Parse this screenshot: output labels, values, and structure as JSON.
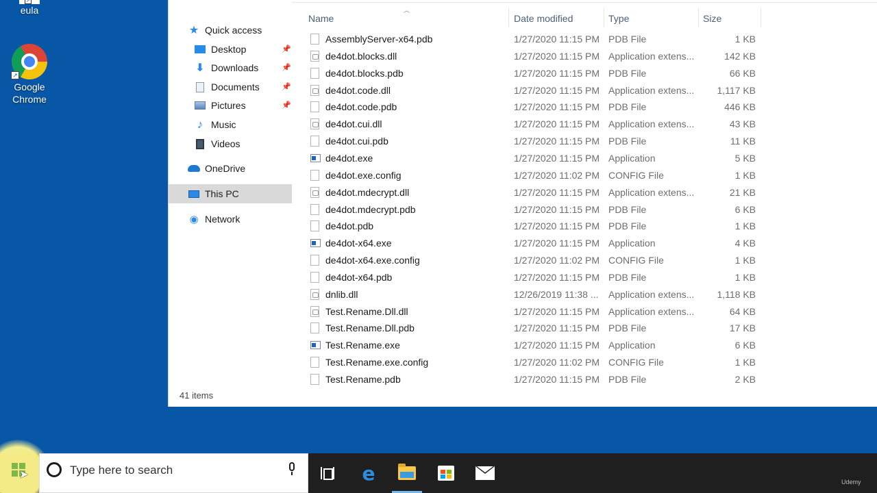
{
  "desktop": {
    "icons": [
      {
        "label": "eula"
      },
      {
        "label": "Google Chrome"
      }
    ]
  },
  "explorer": {
    "nav": {
      "items": [
        {
          "label": "Quick access",
          "icon": "star-icon"
        },
        {
          "label": "Desktop",
          "icon": "desktop-icon",
          "pinned": true
        },
        {
          "label": "Downloads",
          "icon": "download-arrow-icon",
          "pinned": true
        },
        {
          "label": "Documents",
          "icon": "documents-icon",
          "pinned": true
        },
        {
          "label": "Pictures",
          "icon": "pictures-icon",
          "pinned": true
        },
        {
          "label": "Music",
          "icon": "music-note-icon"
        },
        {
          "label": "Videos",
          "icon": "videos-icon"
        },
        {
          "label": "OneDrive",
          "icon": "cloud-icon"
        },
        {
          "label": "This PC",
          "icon": "computer-icon",
          "selected": true
        },
        {
          "label": "Network",
          "icon": "network-icon"
        }
      ],
      "pin_glyph": "📌"
    },
    "columns": {
      "name": "Name",
      "date": "Date modified",
      "type": "Type",
      "size": "Size"
    },
    "files": [
      {
        "name": "AssemblyServer-x64.pdb",
        "date": "1/27/2020 11:15 PM",
        "type": "PDB File",
        "size": "1 KB",
        "kind": "file"
      },
      {
        "name": "de4dot.blocks.dll",
        "date": "1/27/2020 11:15 PM",
        "type": "Application extens...",
        "size": "142 KB",
        "kind": "dll"
      },
      {
        "name": "de4dot.blocks.pdb",
        "date": "1/27/2020 11:15 PM",
        "type": "PDB File",
        "size": "66 KB",
        "kind": "file"
      },
      {
        "name": "de4dot.code.dll",
        "date": "1/27/2020 11:15 PM",
        "type": "Application extens...",
        "size": "1,117 KB",
        "kind": "dll"
      },
      {
        "name": "de4dot.code.pdb",
        "date": "1/27/2020 11:15 PM",
        "type": "PDB File",
        "size": "446 KB",
        "kind": "file"
      },
      {
        "name": "de4dot.cui.dll",
        "date": "1/27/2020 11:15 PM",
        "type": "Application extens...",
        "size": "43 KB",
        "kind": "dll"
      },
      {
        "name": "de4dot.cui.pdb",
        "date": "1/27/2020 11:15 PM",
        "type": "PDB File",
        "size": "11 KB",
        "kind": "file"
      },
      {
        "name": "de4dot.exe",
        "date": "1/27/2020 11:15 PM",
        "type": "Application",
        "size": "5 KB",
        "kind": "exe"
      },
      {
        "name": "de4dot.exe.config",
        "date": "1/27/2020 11:02 PM",
        "type": "CONFIG File",
        "size": "1 KB",
        "kind": "file"
      },
      {
        "name": "de4dot.mdecrypt.dll",
        "date": "1/27/2020 11:15 PM",
        "type": "Application extens...",
        "size": "21 KB",
        "kind": "dll"
      },
      {
        "name": "de4dot.mdecrypt.pdb",
        "date": "1/27/2020 11:15 PM",
        "type": "PDB File",
        "size": "6 KB",
        "kind": "file"
      },
      {
        "name": "de4dot.pdb",
        "date": "1/27/2020 11:15 PM",
        "type": "PDB File",
        "size": "1 KB",
        "kind": "file"
      },
      {
        "name": "de4dot-x64.exe",
        "date": "1/27/2020 11:15 PM",
        "type": "Application",
        "size": "4 KB",
        "kind": "exe"
      },
      {
        "name": "de4dot-x64.exe.config",
        "date": "1/27/2020 11:02 PM",
        "type": "CONFIG File",
        "size": "1 KB",
        "kind": "file"
      },
      {
        "name": "de4dot-x64.pdb",
        "date": "1/27/2020 11:15 PM",
        "type": "PDB File",
        "size": "1 KB",
        "kind": "file"
      },
      {
        "name": "dnlib.dll",
        "date": "12/26/2019 11:38 ...",
        "type": "Application extens...",
        "size": "1,118 KB",
        "kind": "dll"
      },
      {
        "name": "Test.Rename.Dll.dll",
        "date": "1/27/2020 11:15 PM",
        "type": "Application extens...",
        "size": "64 KB",
        "kind": "dll"
      },
      {
        "name": "Test.Rename.Dll.pdb",
        "date": "1/27/2020 11:15 PM",
        "type": "PDB File",
        "size": "17 KB",
        "kind": "file"
      },
      {
        "name": "Test.Rename.exe",
        "date": "1/27/2020 11:15 PM",
        "type": "Application",
        "size": "6 KB",
        "kind": "exe"
      },
      {
        "name": "Test.Rename.exe.config",
        "date": "1/27/2020 11:02 PM",
        "type": "CONFIG File",
        "size": "1 KB",
        "kind": "file"
      },
      {
        "name": "Test.Rename.pdb",
        "date": "1/27/2020 11:15 PM",
        "type": "PDB File",
        "size": "2 KB",
        "kind": "file"
      }
    ],
    "status": "41 items"
  },
  "taskbar": {
    "search_placeholder": "Type here to search",
    "edge_glyph": "e",
    "icons": [
      "task-view-icon",
      "edge-icon",
      "file-explorer-icon",
      "store-icon",
      "mail-icon"
    ]
  },
  "watermark": "Udemy",
  "colors": {
    "desktop_bg": "#0757a6",
    "taskbar_bg": "#1f1f1f",
    "selected_nav": "#d9d9d9",
    "accent": "#2a8ae6"
  }
}
